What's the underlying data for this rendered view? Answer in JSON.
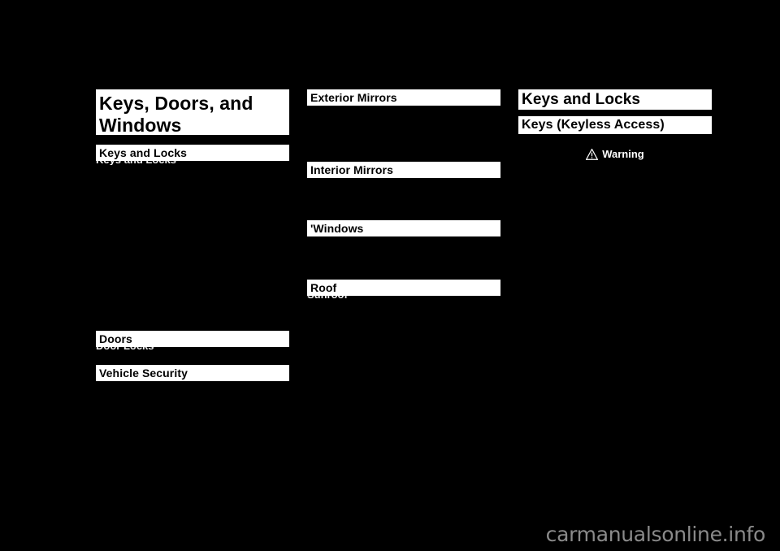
{
  "page": {
    "background_color": "#000000",
    "band_color": "#ffffff",
    "text_color": "#000000",
    "watermark": "carmanualsonline.info",
    "watermark_color": "#8a8a8a"
  },
  "chapter": {
    "title_line_1": "Keys, Doors, and",
    "title_line_2": "Windows"
  },
  "columns": {
    "left": {
      "headings": [
        {
          "label": "Keys and Locks",
          "clipped_next_line": "Keys and Locks"
        },
        {
          "label": "Doors",
          "clipped_next_line": "Door Locks"
        },
        {
          "label": "Vehicle Security",
          "clipped_next_line": ""
        }
      ]
    },
    "middle": {
      "headings": [
        {
          "label": "Exterior Mirrors",
          "clipped_next_line": ""
        },
        {
          "label": "Interior Mirrors",
          "clipped_next_line": ""
        },
        {
          "label": "'Windows",
          "clipped_next_line": ""
        },
        {
          "label": "Roof",
          "clipped_next_line": "Sunroof"
        }
      ]
    },
    "right": {
      "section_heading": "Keys and Locks",
      "subsection_heading": "Keys (Keyless Access)",
      "warning": {
        "icon": "warning-triangle-icon",
        "label": "Warning"
      }
    }
  }
}
